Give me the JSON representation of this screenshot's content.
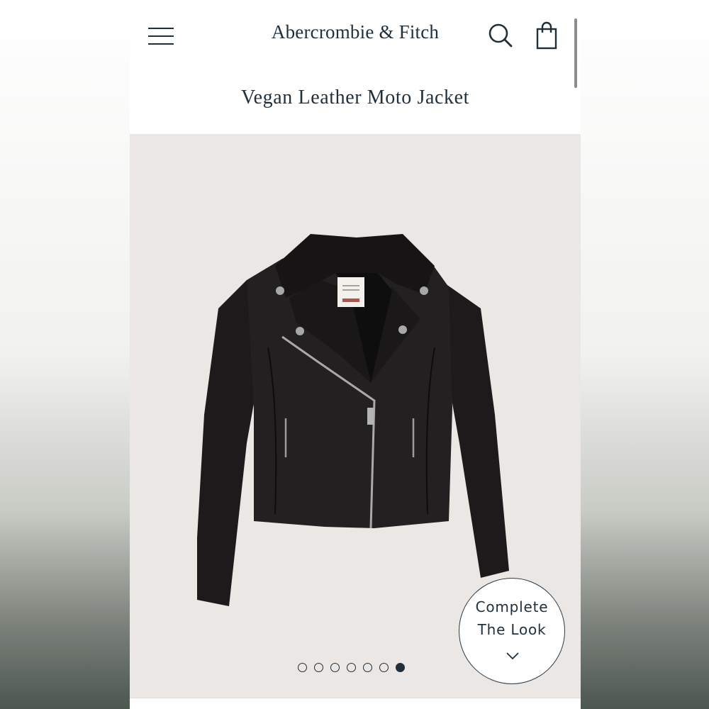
{
  "header": {
    "brand": "Abercrombie & Fitch",
    "menu_icon": "hamburger-menu-icon",
    "search_icon": "search-icon",
    "bag_icon": "shopping-bag-icon"
  },
  "product": {
    "title": "Vegan Leather Moto Jacket",
    "image_alt": "black vegan leather moto jacket",
    "carousel": {
      "total": 7,
      "active_index": 7
    }
  },
  "complete_the_look": {
    "line1": "Complete",
    "line2": "The Look",
    "icon": "chevron-down-icon"
  },
  "colors": {
    "text": "#1f2f3c",
    "background": "#ebe7e5",
    "jacket": "#1c1a1b"
  }
}
